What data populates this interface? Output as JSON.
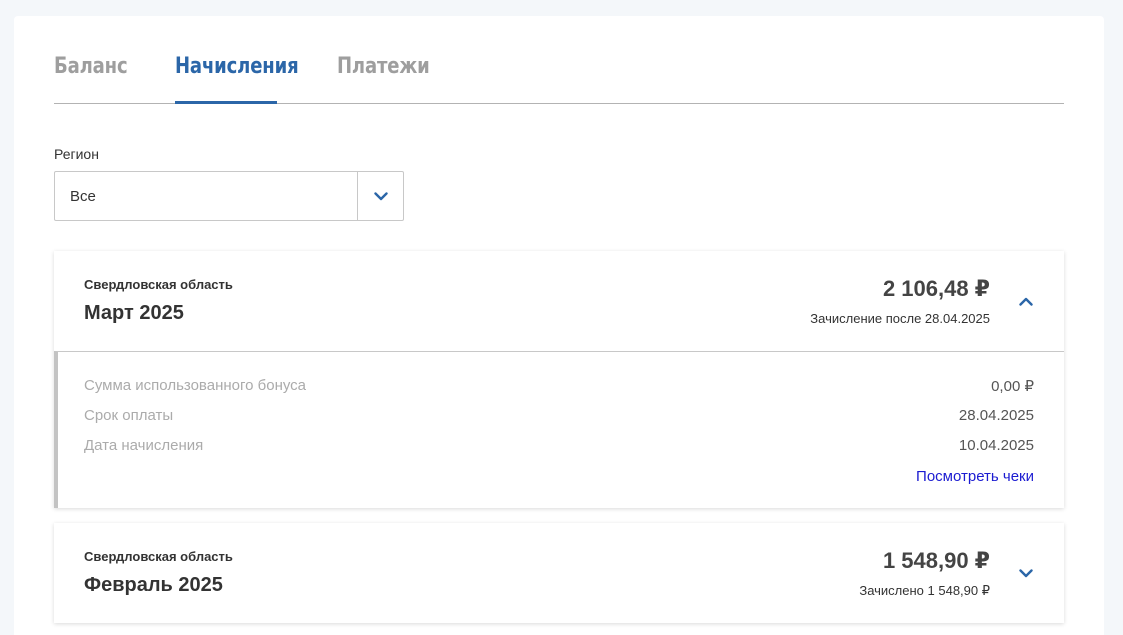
{
  "tabs": [
    {
      "label": "Баланс"
    },
    {
      "label": "Начисления"
    },
    {
      "label": "Платежи"
    }
  ],
  "active_tab": "Начисления",
  "accent_color": "#2b66a8",
  "region": {
    "label": "Регион",
    "selected": "Все"
  },
  "charges": [
    {
      "region": "Свердловская область",
      "month": "Март 2025",
      "amount": "2 106,48 ₽",
      "note": "Зачисление после 28.04.2025",
      "expanded": true,
      "details": [
        {
          "label": "Сумма использованного бонуса",
          "value": "0,00 ₽"
        },
        {
          "label": "Срок оплаты",
          "value": "28.04.2025"
        },
        {
          "label": "Дата начисления",
          "value": "10.04.2025"
        }
      ],
      "link": "Посмотреть чеки"
    },
    {
      "region": "Свердловская область",
      "month": "Февраль 2025",
      "amount": "1 548,90 ₽",
      "note": "Зачислено 1 548,90 ₽",
      "expanded": false
    }
  ]
}
